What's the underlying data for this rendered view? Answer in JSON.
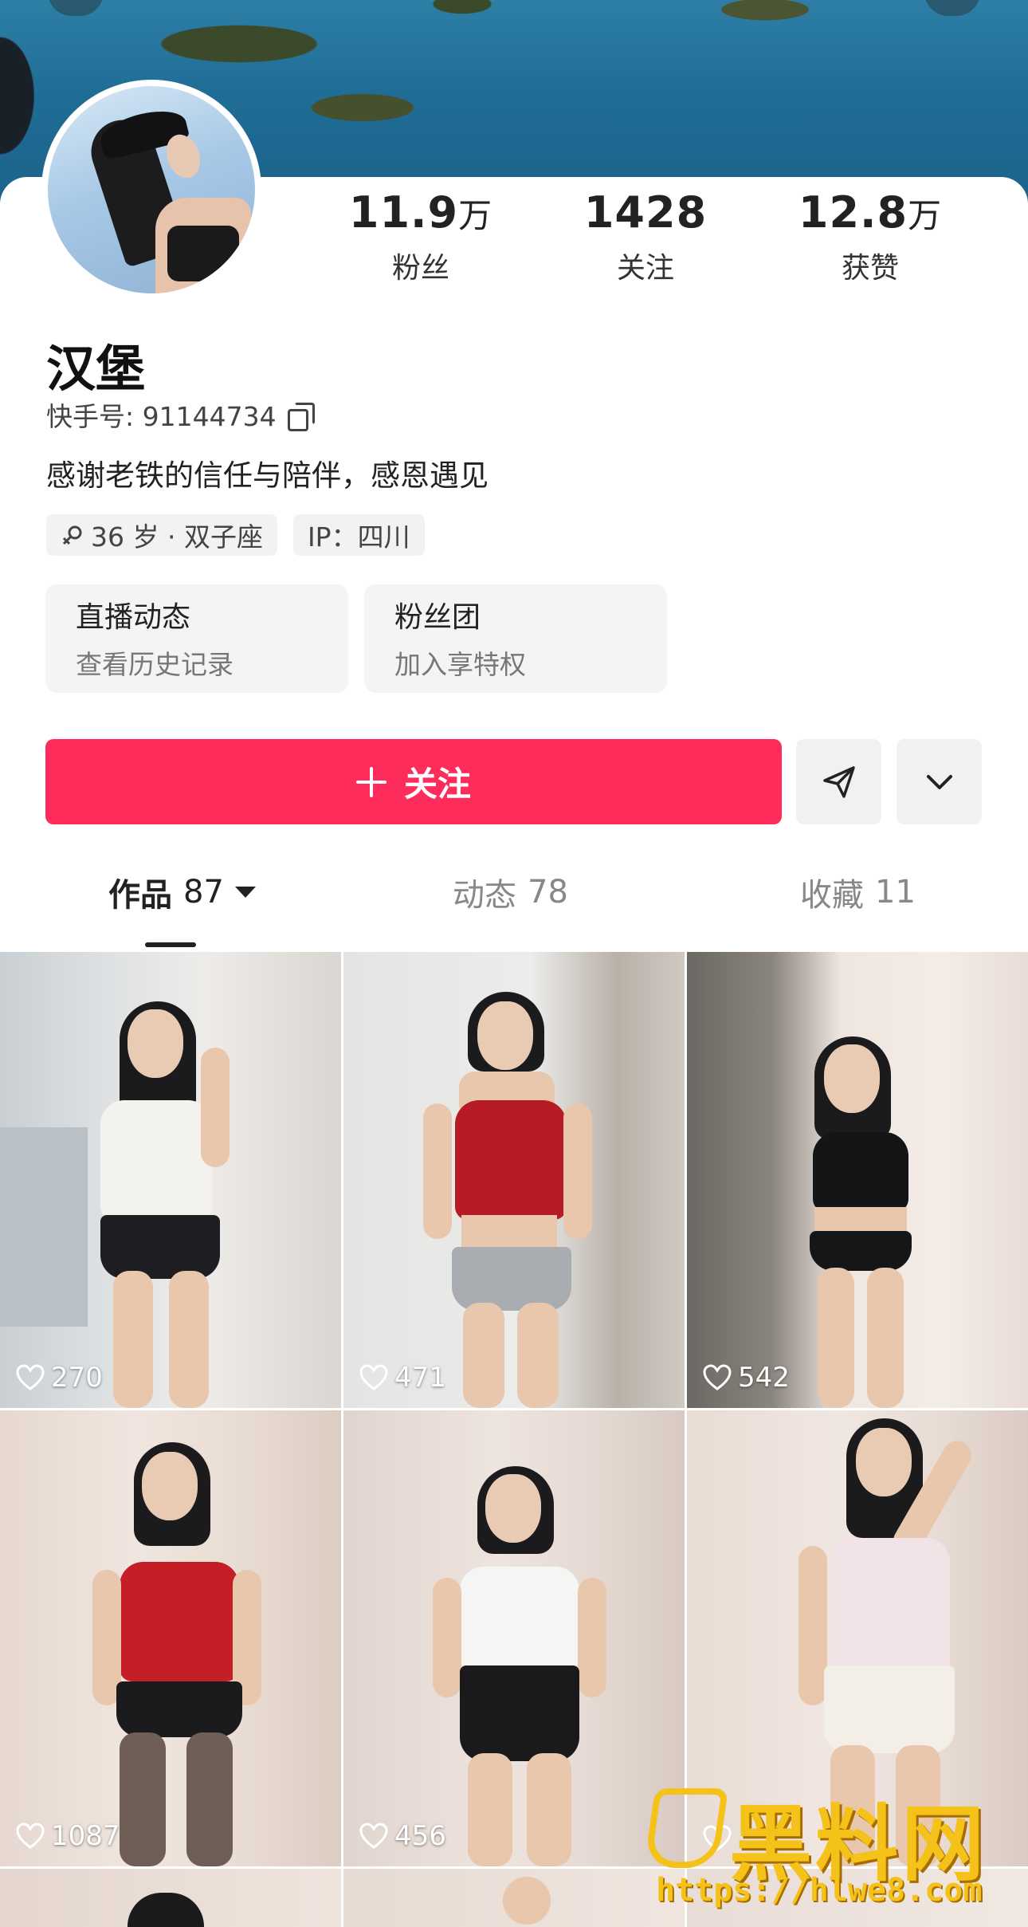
{
  "profile": {
    "name": "汉堡",
    "kuaishou_id": "快手号: 91144734",
    "bio": "感谢老铁的信任与陪伴，感恩遇见",
    "tags": [
      "36 岁 · 双子座",
      "IP：四川"
    ],
    "stats": [
      {
        "value": "11.9",
        "unit": "万",
        "label": "粉丝"
      },
      {
        "value": "1428",
        "unit": "",
        "label": "关注"
      },
      {
        "value": "12.8",
        "unit": "万",
        "label": "获赞"
      }
    ]
  },
  "tiles": [
    {
      "title": "直播动态",
      "subtitle": "查看历史记录"
    },
    {
      "title": "粉丝团",
      "subtitle": "加入享特权"
    }
  ],
  "actions": {
    "follow_label": "关注",
    "share_icon": "send-icon",
    "more_icon": "chevron-down-icon"
  },
  "tabs": [
    {
      "label": "作品",
      "count": "87"
    },
    {
      "label": "动态",
      "count": "78"
    },
    {
      "label": "收藏",
      "count": "11"
    }
  ],
  "videos": [
    {
      "likes": "270"
    },
    {
      "likes": "471"
    },
    {
      "likes": "542"
    },
    {
      "likes": "1087"
    },
    {
      "likes": "456"
    },
    {
      "likes": ""
    }
  ],
  "watermark": {
    "title": "黑料网",
    "url": "https://hlwe8.com"
  },
  "colors": {
    "accent": "#fe2c5a",
    "watermark": "#f5c21a"
  }
}
